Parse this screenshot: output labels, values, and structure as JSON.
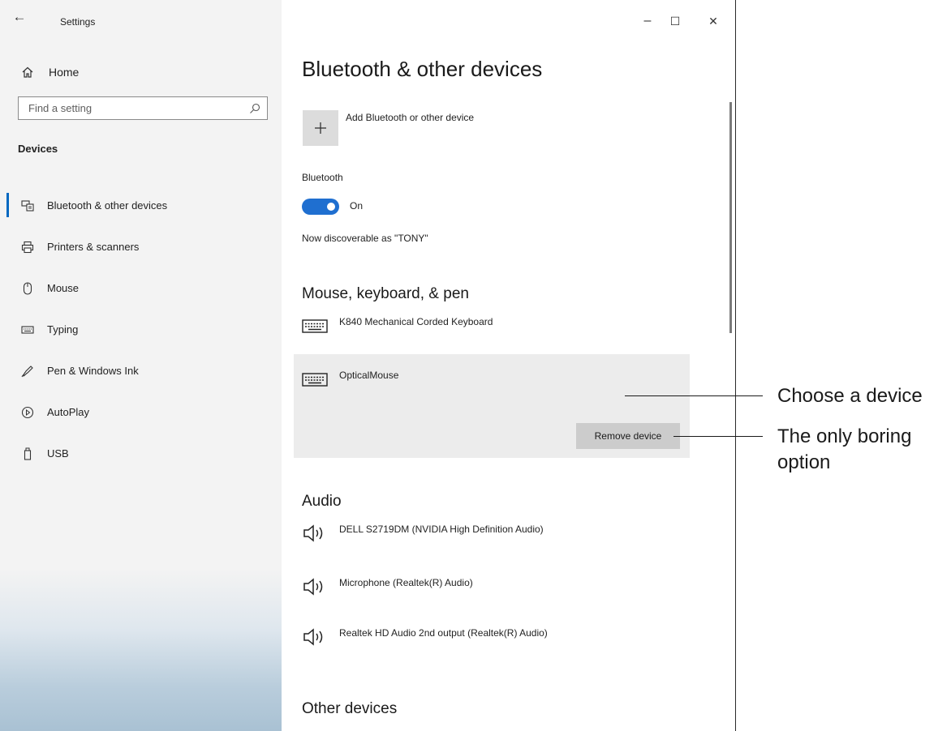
{
  "window": {
    "title": "Settings",
    "controls": {
      "minimize": "–",
      "maximize": "☐",
      "close": "✕"
    }
  },
  "sidebar": {
    "home_label": "Home",
    "search_placeholder": "Find a setting",
    "section_label": "Devices",
    "items": [
      {
        "label": "Bluetooth & other devices",
        "icon": "bluetooth-devices-icon",
        "active": true
      },
      {
        "label": "Printers & scanners",
        "icon": "printer-icon",
        "active": false
      },
      {
        "label": "Mouse",
        "icon": "mouse-icon",
        "active": false
      },
      {
        "label": "Typing",
        "icon": "keyboard-icon",
        "active": false
      },
      {
        "label": "Pen & Windows Ink",
        "icon": "pen-icon",
        "active": false
      },
      {
        "label": "AutoPlay",
        "icon": "autoplay-icon",
        "active": false
      },
      {
        "label": "USB",
        "icon": "usb-icon",
        "active": false
      }
    ]
  },
  "main": {
    "page_title": "Bluetooth & other devices",
    "add_device_label": "Add Bluetooth or other device",
    "bluetooth_label": "Bluetooth",
    "bluetooth_state": "On",
    "discoverable_text": "Now discoverable as \"TONY\"",
    "mouse_section": {
      "title": "Mouse, keyboard, & pen",
      "devices": [
        {
          "name": "K840 Mechanical Corded Keyboard",
          "icon": "keyboard-icon"
        },
        {
          "name": "OpticalMouse",
          "icon": "keyboard-icon",
          "selected": true
        }
      ],
      "remove_button_label": "Remove device"
    },
    "audio_section": {
      "title": "Audio",
      "devices": [
        {
          "name": "DELL S2719DM (NVIDIA High Definition Audio)",
          "icon": "speaker-icon"
        },
        {
          "name": "Microphone (Realtek(R) Audio)",
          "icon": "speaker-icon"
        },
        {
          "name": "Realtek HD Audio 2nd output (Realtek(R) Audio)",
          "icon": "speaker-icon"
        }
      ]
    },
    "other_section": {
      "title": "Other devices"
    }
  },
  "callouts": {
    "choose_device": "Choose a device",
    "boring_option_line1": "The only boring",
    "boring_option_line2": "option"
  },
  "colors": {
    "accent": "#0067c0",
    "toggle": "#1f6fd0",
    "selected_bg": "#ececec",
    "button_bg": "#cccccc"
  }
}
